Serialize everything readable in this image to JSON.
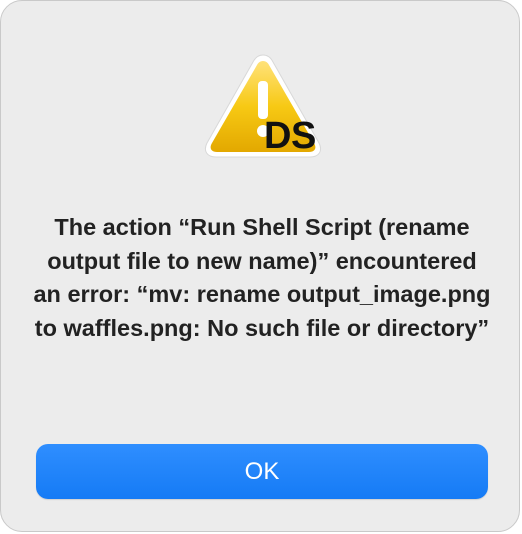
{
  "dialog": {
    "icon": "warning-triangle-icon",
    "app_badge_text": "DS",
    "message": "The action “Run Shell Script (rename output file to new name)” encountered an error: “mv: rename output_image.png to waffles.png: No such file or directory”",
    "ok_label": "OK"
  },
  "colors": {
    "dialog_background": "#ececec",
    "warning_yellow": "#f5c400",
    "button_blue": "#1a82fb",
    "button_text": "#ffffff",
    "message_text": "#222222"
  }
}
